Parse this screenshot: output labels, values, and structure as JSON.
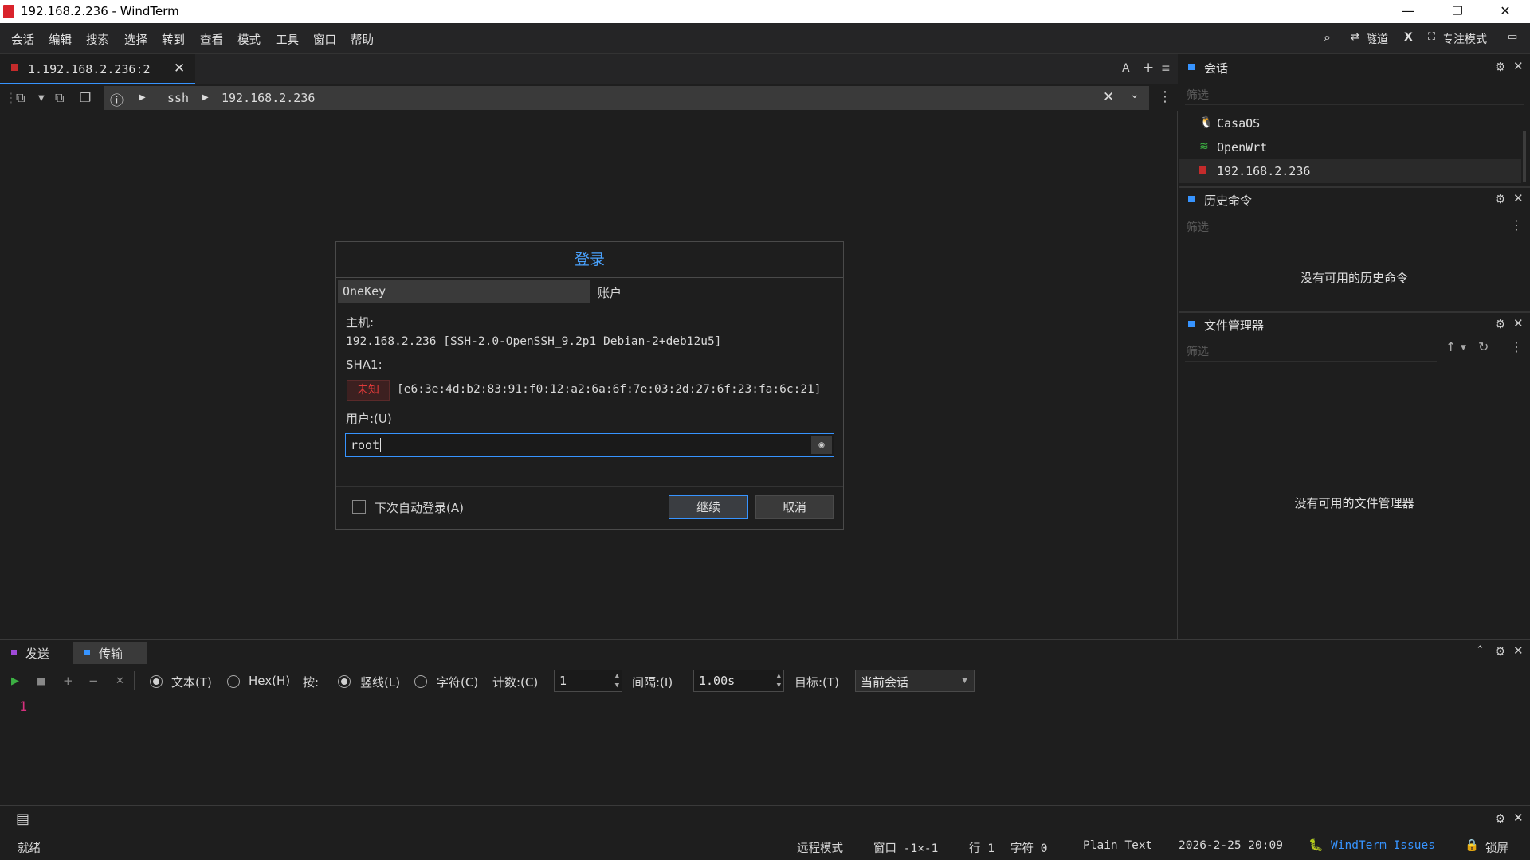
{
  "window": {
    "title": "192.168.2.236 - WindTerm",
    "minimize": "—",
    "restore": "❐",
    "close": "✕"
  },
  "menu": {
    "items": [
      "会话",
      "编辑",
      "搜索",
      "选择",
      "转到",
      "查看",
      "模式",
      "工具",
      "窗口",
      "帮助"
    ],
    "right": {
      "search_icon": "⌕",
      "tunnel": "隧道",
      "x_label": "X",
      "focus_mode": "专注模式"
    }
  },
  "tabs": [
    {
      "label": "1.192.168.2.236:2",
      "close": "✕"
    }
  ],
  "tabbar_controls": {
    "font": "A",
    "add": "+",
    "menu": "≡"
  },
  "address": {
    "protocol": "ssh",
    "host": "192.168.2.236",
    "clear": "✕",
    "dropdown": "⌄",
    "more": "⋮"
  },
  "dialog": {
    "title": "登录",
    "tabs": {
      "onekey": "OneKey",
      "account": "账户"
    },
    "host_label": "主机:",
    "host_value": "192.168.2.236 [SSH-2.0-OpenSSH_9.2p1 Debian-2+deb12u5]",
    "sha1_label": "SHA1:",
    "sha1_status": "未知",
    "sha1_value": "[e6:3e:4d:b2:83:91:f0:12:a2:6a:6f:7e:03:2d:27:6f:23:fa:6c:21]",
    "user_label": "用户:(U)",
    "user_value": "root",
    "auto_login_label": "下次自动登录(A)",
    "continue_label": "继续",
    "cancel_label": "取消"
  },
  "sessions_panel": {
    "title": "会话",
    "filter_placeholder": "筛选",
    "items": [
      {
        "name": "CasaOS",
        "icon": "linux-icon"
      },
      {
        "name": "OpenWrt",
        "icon": "wifi-icon"
      },
      {
        "name": "192.168.2.236",
        "icon": "terminal-icon"
      }
    ]
  },
  "history_panel": {
    "title": "历史命令",
    "filter_placeholder": "筛选",
    "empty": "没有可用的历史命令"
  },
  "files_panel": {
    "title": "文件管理器",
    "filter_placeholder": "筛选",
    "empty": "没有可用的文件管理器"
  },
  "send_panel": {
    "tabs": [
      "发送",
      "传输"
    ],
    "text_label": "文本(T)",
    "hex_label": "Hex(H)",
    "by_label": "按:",
    "line_label": "竖线(L)",
    "char_label": "字符(C)",
    "count_label": "计数:(C)",
    "count_value": "1",
    "interval_label": "间隔:(I)",
    "interval_value": "1.00s",
    "target_label": "目标:(T)",
    "target_value": "当前会话",
    "line_number": "1"
  },
  "statusbar": {
    "ready": "就绪",
    "remote_mode": "远程模式",
    "window_info": "窗口 -1×-1",
    "line": "行 1",
    "char": "字符 0",
    "syntax": "Plain Text",
    "datetime": "2026-2-25 20:09",
    "issues_link": "WindTerm Issues",
    "lock": "锁屏"
  },
  "colors": {
    "accent": "#3794ff",
    "danger": "#c42b2b",
    "background": "#1e1e1e"
  }
}
